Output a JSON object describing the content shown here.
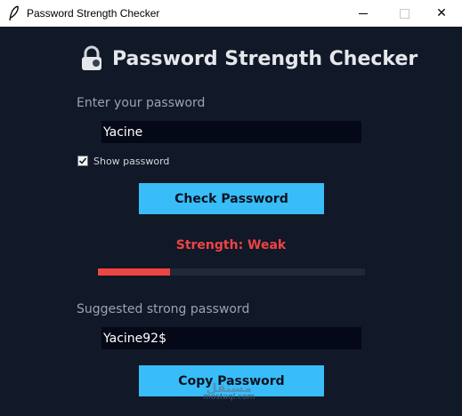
{
  "window": {
    "title": "Password Strength Checker",
    "icon": "feather-icon",
    "controls": [
      "minimize-icon",
      "maximize-icon",
      "close-icon"
    ],
    "close_glyph": "✕"
  },
  "app": {
    "title": "Password Strength Checker",
    "title_icon": "lock-icon"
  },
  "password": {
    "label": "Enter your password",
    "value": "Yacine"
  },
  "show_password": {
    "label": "Show password",
    "checked": true
  },
  "check_button": {
    "label": "Check Password"
  },
  "strength": {
    "text": "Strength: Weak",
    "level": 0.27,
    "color": "#ef4444"
  },
  "suggested": {
    "label": "Suggested strong password",
    "value": "Yacine92$"
  },
  "copy_button": {
    "label": "Copy Password"
  },
  "watermark": {
    "line1": "مستقل",
    "line2": "mostaql.com"
  },
  "colors": {
    "background": "#111827",
    "accent": "#38bdf8",
    "weak": "#ef4444",
    "field_bg": "#050816",
    "track": "#1f2937"
  }
}
